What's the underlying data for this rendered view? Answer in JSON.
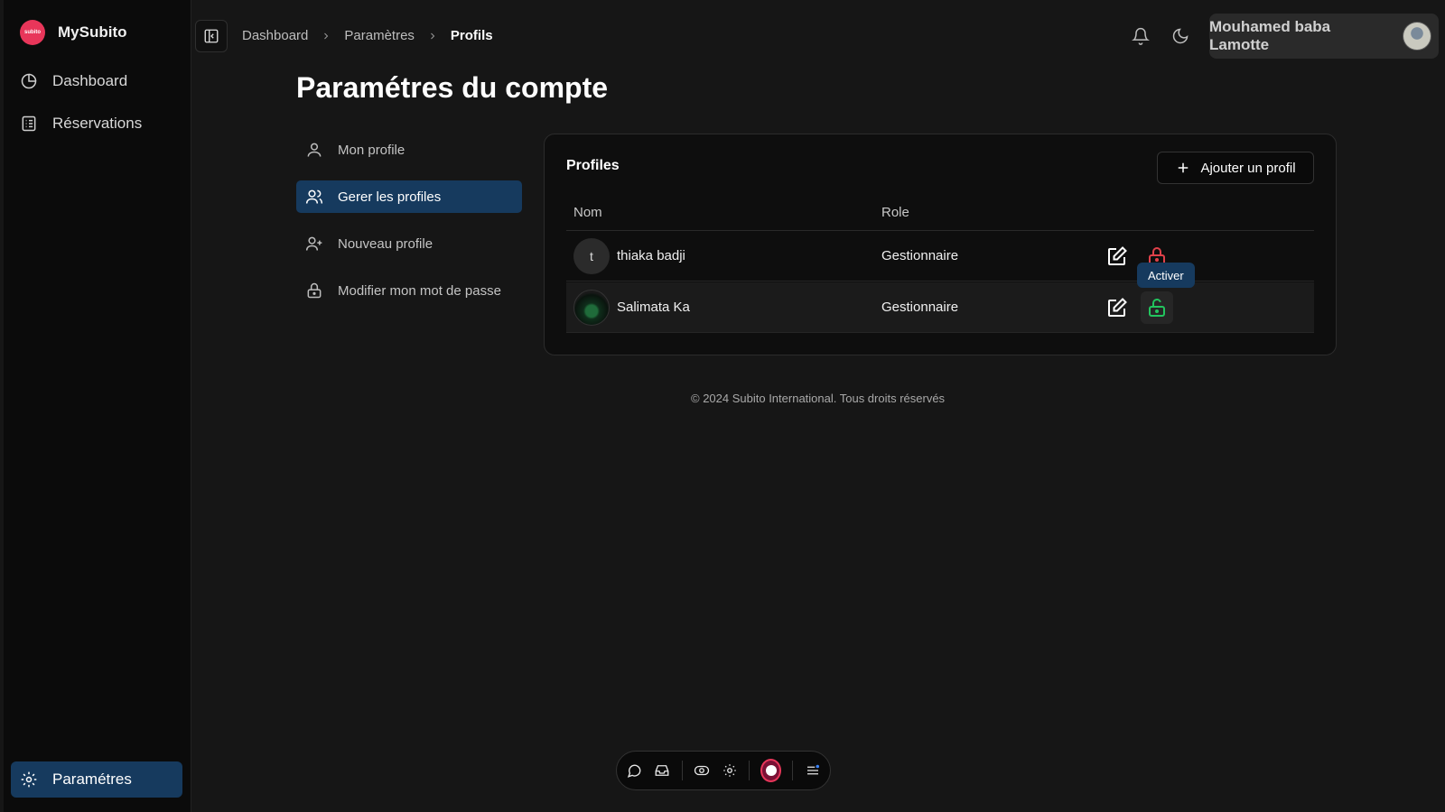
{
  "app": {
    "brand_name": "MySubito",
    "logo_text": "subito"
  },
  "sidebar": {
    "items": [
      {
        "label": "Dashboard",
        "icon": "pie-chart-icon"
      },
      {
        "label": "Réservations",
        "icon": "list-icon"
      }
    ],
    "bottom_item": {
      "label": "Paramétres",
      "icon": "gear-icon",
      "active": true
    }
  },
  "breadcrumb": {
    "items": [
      "Dashboard",
      "Paramètres"
    ],
    "current": "Profils"
  },
  "header": {
    "user_name": "Mouhamed baba Lamotte"
  },
  "page": {
    "title": "Paramétres du compte"
  },
  "settings_nav": {
    "items": [
      {
        "label": "Mon profile",
        "icon": "user-icon"
      },
      {
        "label": "Gerer les profiles",
        "icon": "users-icon",
        "active": true
      },
      {
        "label": "Nouveau profile",
        "icon": "user-plus-icon"
      },
      {
        "label": "Modifier mon mot de passe",
        "icon": "lock-icon"
      }
    ]
  },
  "profiles": {
    "title": "Profiles",
    "add_button": "Ajouter un profil",
    "columns": [
      "Nom",
      "Role"
    ],
    "rows": [
      {
        "initial": "t",
        "name": "thiaka badji",
        "role": "Gestionnaire",
        "status": "locked"
      },
      {
        "initial": "",
        "name": "Salimata Ka",
        "role": "Gestionnaire",
        "status": "unlocked"
      }
    ],
    "tooltip": "Activer"
  },
  "footer": {
    "text": "© 2024 Subito International. Tous droits réservés"
  },
  "colors": {
    "accent": "#163a5e",
    "brand": "#e8365a",
    "lock_red": "#e0414a",
    "unlock_green": "#22c55e"
  }
}
